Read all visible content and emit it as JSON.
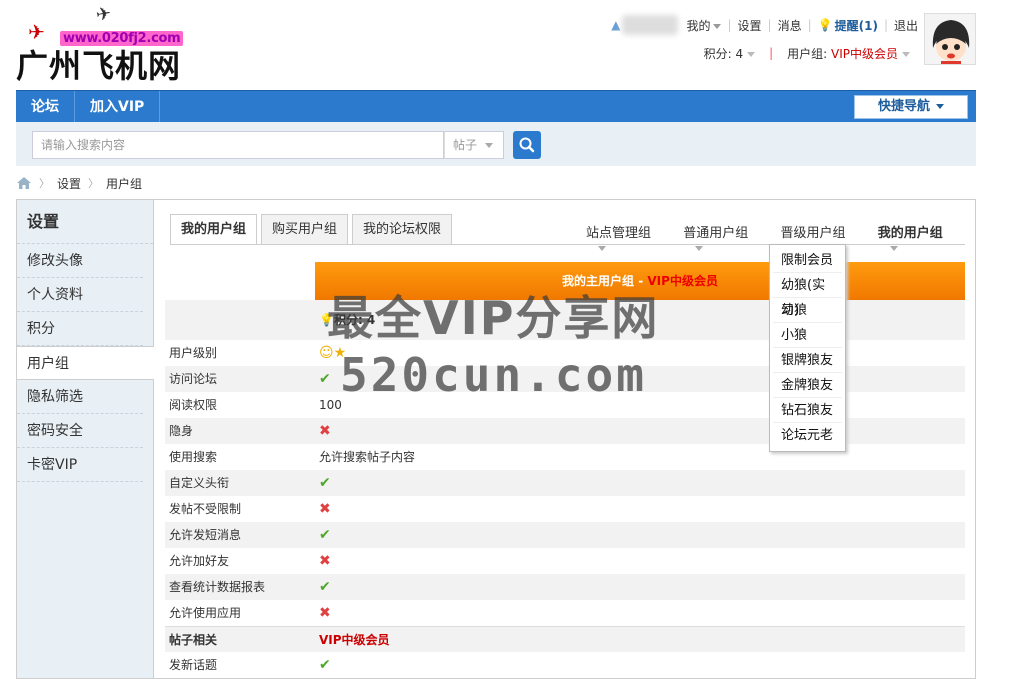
{
  "logo": {
    "url_text": "www.020fj2.com",
    "site_name": "广州飞机网"
  },
  "user_bar": {
    "my": "我的",
    "settings": "设置",
    "messages": "消息",
    "remind": "提醒(1)",
    "logout": "退出",
    "points": "积分: 4",
    "usergroup_label": "用户组: ",
    "usergroup_value": "VIP中级会员"
  },
  "nav": {
    "items": [
      "论坛",
      "加入VIP"
    ],
    "quick_nav": "快捷导航"
  },
  "search": {
    "placeholder": "请输入搜索内容",
    "type": "帖子"
  },
  "breadcrumb": {
    "items": [
      "设置",
      "用户组"
    ]
  },
  "sidebar": {
    "title": "设置",
    "items": [
      "修改头像",
      "个人资料",
      "积分",
      "用户组",
      "隐私筛选",
      "密码安全",
      "卡密VIP"
    ],
    "active_index": 3
  },
  "tabs": [
    "我的用户组",
    "购买用户组",
    "我的论坛权限"
  ],
  "group_nav": [
    "站点管理组",
    "普通用户组",
    "晋级用户组",
    "我的用户组"
  ],
  "dropdown": [
    "限制会员",
    "幼狼(实习)",
    "幼狼",
    "小狼",
    "银牌狼友",
    "金牌狼友",
    "钻石狼友",
    "论坛元老"
  ],
  "group_table": {
    "header_prefix": "我的主用户组 - ",
    "header_group": "VIP中级会员",
    "points": "积分: 4",
    "rows": [
      {
        "label": "用户级别",
        "value": "☺★"
      },
      {
        "label": "访问论坛",
        "value": "✔"
      },
      {
        "label": "阅读权限",
        "value": "100"
      },
      {
        "label": "隐身",
        "value": "✖"
      },
      {
        "label": "使用搜索",
        "value": "允许搜索帖子内容"
      },
      {
        "label": "自定义头衔",
        "value": "✔"
      },
      {
        "label": "发帖不受限制",
        "value": "✖"
      },
      {
        "label": "允许发短消息",
        "value": "✔"
      },
      {
        "label": "允许加好友",
        "value": "✖"
      },
      {
        "label": "查看统计数据报表",
        "value": "✔"
      },
      {
        "label": "允许使用应用",
        "value": "✖"
      }
    ],
    "section_label": "帖子相关",
    "section_value": "VIP中级会员",
    "next_row": {
      "label": "发新话题",
      "value": "✔"
    }
  },
  "watermark": {
    "line1": "最全VIP分享网",
    "line2": "520cun.com"
  }
}
